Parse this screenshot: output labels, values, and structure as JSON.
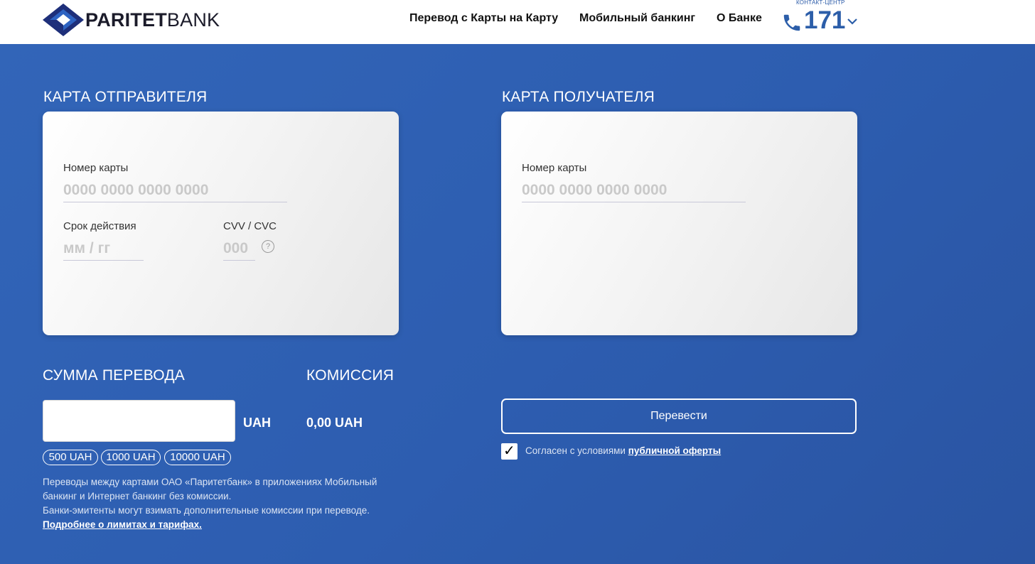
{
  "header": {
    "logo_bold": "PARITET",
    "logo_light": "BANK",
    "nav": [
      "Перевод с Карты на Карту",
      "Мобильный банкинг",
      "О Банке"
    ],
    "contact_label": "КОНТАКТ-ЦЕНТР",
    "contact_number": "171"
  },
  "sender": {
    "title": "КАРТА ОТПРАВИТЕЛЯ",
    "card_number_label": "Номер карты",
    "card_number_placeholder": "0000 0000 0000 0000",
    "card_number_value": "",
    "expiry_label": "Срок действия",
    "expiry_placeholder": "мм / гг",
    "expiry_value": "",
    "cvv_label": "CVV / CVC",
    "cvv_placeholder": "000",
    "cvv_value": "",
    "help_symbol": "?"
  },
  "recipient": {
    "title": "КАРТА ПОЛУЧАТЕЛЯ",
    "card_number_label": "Номер карты",
    "card_number_placeholder": "0000 0000 0000 0000",
    "card_number_value": ""
  },
  "amount": {
    "title": "СУММА ПЕРЕВОДА",
    "value": "",
    "currency": "UAH",
    "presets": [
      "500 UAH",
      "1000 UAH",
      "10000 UAH"
    ]
  },
  "commission": {
    "title": "КОМИССИЯ",
    "value": "0,00 UAH"
  },
  "info": {
    "line1": "Переводы между картами ОАО «Паритетбанк» в приложениях Мобильный",
    "line2": "банкинг и Интернет банкинг без комиссии.",
    "line3": "Банки-эмитенты могут взимать дополнительные комиссии при переводе.",
    "link": "Подробнее о лимитах и тарифах."
  },
  "submit_label": "Перевести",
  "agreement": {
    "checked": true,
    "checkmark": "✓",
    "text": "Согласен с условиями ",
    "link": "публичной оферты"
  },
  "colors": {
    "background": "#2d5db0",
    "brand_dark": "#1e2f7a",
    "brand_accent": "#2c5ea9",
    "card": "#f2f2f2"
  },
  "icons": {
    "logo": "paritet-diamond-logo",
    "phone": "phone-icon",
    "chevron": "chevron-down-icon",
    "help": "question-circle-icon",
    "check": "checkmark-icon"
  }
}
